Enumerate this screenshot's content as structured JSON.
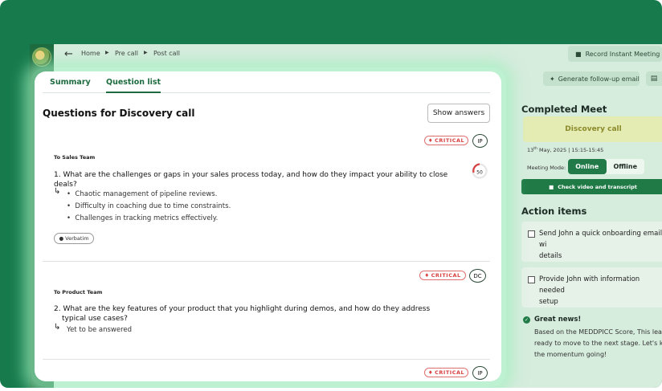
{
  "breadcrumb": {
    "home": "Home",
    "pre_call": "Pre call",
    "post_call": "Post call"
  },
  "toolbar": {
    "record_label": "Record Instant Meeting",
    "followup_label": "Generate follow-up email"
  },
  "tabs": [
    {
      "label": "Summary",
      "active": false
    },
    {
      "label": "Question list",
      "active": true
    }
  ],
  "main": {
    "title": "Questions for Discovery call",
    "show_answers_label": "Show answers",
    "questions": [
      {
        "team": "To Sales Team",
        "priority": "CRITICAL",
        "owner": "IP",
        "score": "50",
        "text_line1": "1. What are the challenges or gaps in your sales process today, and how do they impact your ability to close",
        "text_line2": "deals?",
        "answers": [
          "Chaotic management of pipeline reviews.",
          "Difficulty in coaching due to time constraints.",
          "Challenges in tracking metrics effectively."
        ],
        "source_label": "Verbatim"
      },
      {
        "team": "To Product Team",
        "priority": "CRITICAL",
        "owner": "DC",
        "text_line1": "2. What are the key features of your product that you highlight during demos, and how do they address",
        "text_line2": "typical use cases?",
        "answer": "Yet to be answered"
      },
      {
        "priority": "CRITICAL",
        "owner": "IP"
      }
    ]
  },
  "completed_meet": {
    "title": "Completed Meet",
    "call_type": "Discovery call",
    "date_day": "13",
    "date_suffix": "th",
    "date_rest": "May, 2025 | 15:15-15:45",
    "mode_label": "Meeting Mode:",
    "mode_online": "Online",
    "mode_offline": "Offline",
    "active_mode": "Online",
    "check_video_label": "Check video and transcript"
  },
  "action_items": {
    "title": "Action items",
    "items": [
      {
        "line1": "Send John a quick onboarding email wi",
        "line2": "details",
        "checked": false
      },
      {
        "line1": "Provide John with information needed",
        "line2": "setup",
        "checked": false
      }
    ]
  },
  "news": {
    "title": "Great news!",
    "line1": "Based on the MEDDPICC Score, This lea",
    "line2": "ready to move to the next stage. Let's k",
    "line3": "the momentum going!"
  },
  "colors": {
    "brand_green": "#167a4c",
    "accent_green": "#1f7a46",
    "critical_red": "#d94040",
    "call_tag_bg": "#e4ecb4"
  }
}
